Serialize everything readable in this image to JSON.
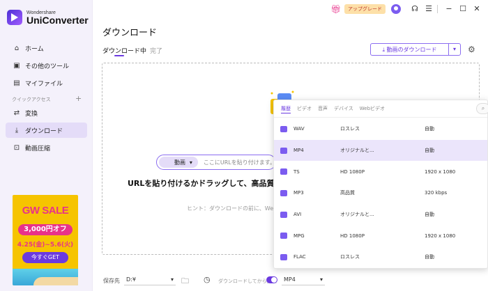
{
  "app": {
    "brand_small": "Wondershare",
    "brand_name": "UniConverter"
  },
  "titlebar": {
    "upgrade_label": "アップグレード"
  },
  "sidebar": {
    "items": [
      {
        "label": "ホーム"
      },
      {
        "label": "その他のツール"
      },
      {
        "label": "マイファイル"
      },
      {
        "label": "変換"
      },
      {
        "label": "ダウンロード"
      },
      {
        "label": "動画圧縮"
      }
    ],
    "section_label": "クイックアクセス",
    "section_plus": "+"
  },
  "banner": {
    "title": "GW SALE",
    "price": "3,000円オフ",
    "dates": "4.25(金)~5.6(火)",
    "button": "今すぐGET"
  },
  "main": {
    "title": "ダウンロード",
    "tab_downloading": "ダウンロード中",
    "tab_done": "完了",
    "download_button": "動画のダウンロード",
    "url_select": "動画",
    "url_placeholder": "ここにURLを貼り付けます。",
    "main_text": "URLを貼り付けるかドラッグして、高品質の動画、",
    "hint": "ヒント：ダウンロードの前に、Webサイ"
  },
  "bottom": {
    "save_label": "保存先",
    "save_path": "D:¥",
    "convert_label": "ダウンロードしてから変換",
    "format": "MP4"
  },
  "format_panel": {
    "tabs": [
      "履歴",
      "ビデオ",
      "音声",
      "デバイス",
      "Webビデオ"
    ],
    "rows": [
      {
        "format": "WAV",
        "quality": "ロスレス",
        "res": "自動"
      },
      {
        "format": "MP4",
        "quality": "オリジナルと...",
        "res": "自動"
      },
      {
        "format": "TS",
        "quality": "HD 1080P",
        "res": "1920 x 1080"
      },
      {
        "format": "MP3",
        "quality": "高品質",
        "res": "320 kbps"
      },
      {
        "format": "AVI",
        "quality": "オリジナルと...",
        "res": "自動"
      },
      {
        "format": "MPG",
        "quality": "HD 1080P",
        "res": "1920 x 1080"
      },
      {
        "format": "FLAC",
        "quality": "ロスレス",
        "res": "自動"
      }
    ]
  },
  "colors": {
    "accent": "#6b3ae0",
    "sidebar_bg": "#f4f1fb",
    "banner_bg": "#f6c400",
    "sale_pink": "#e8328a"
  }
}
